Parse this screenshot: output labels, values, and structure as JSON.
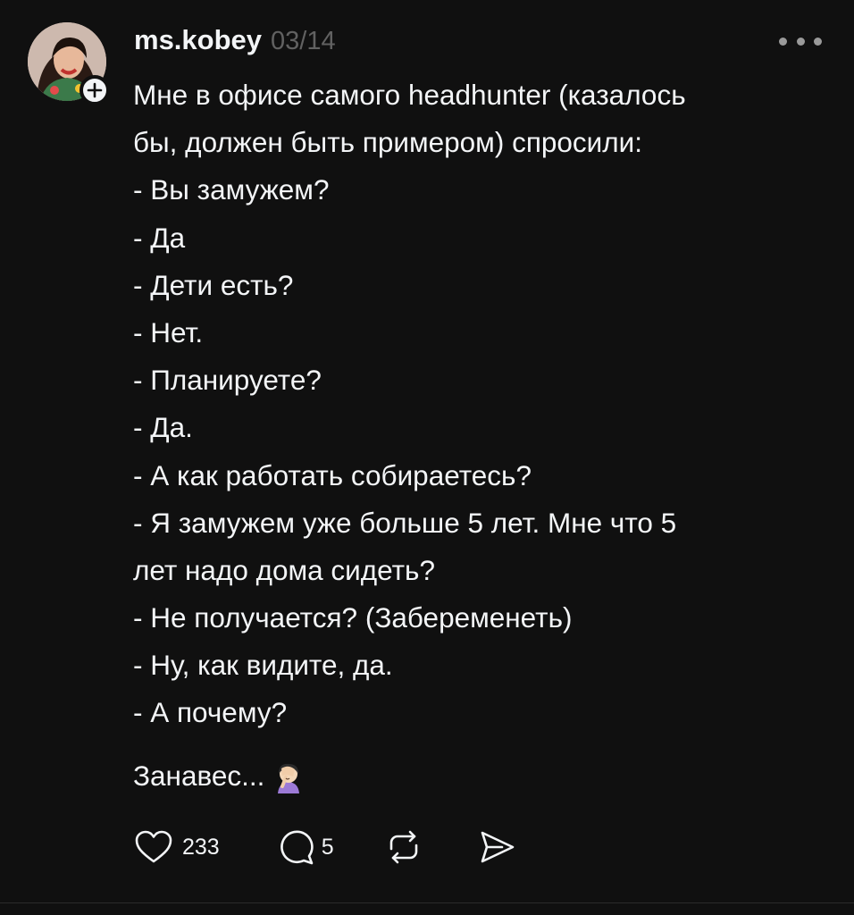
{
  "post": {
    "author": {
      "username": "ms.kobey",
      "avatar_icon": "profile-photo-icon",
      "follow_icon": "plus-icon"
    },
    "timestamp": "03/14",
    "more_icon": "more-dots-icon",
    "lines": [
      "Мне в офисе самого headhunter (казалось",
      "бы, должен быть примером) спросили:",
      "- Вы замужем?",
      "- Да",
      "- Дети есть?",
      "- Нет.",
      "- Планируете?",
      "- Да.",
      "- А как работать собираетесь?",
      "- Я замужем уже больше 5 лет. Мне что 5",
      "лет надо дома сидеть?",
      "- Не получается? (Забеременеть)",
      "- Ну, как видите, да.",
      "- А почему?"
    ],
    "closing_line": "Занавес...",
    "closing_emoji": "face-palm-emoji-icon"
  },
  "actions": {
    "likes": "233",
    "replies": "5",
    "like_icon": "heart-icon",
    "reply_icon": "comment-icon",
    "repost_icon": "repost-icon",
    "share_icon": "send-icon"
  },
  "colors": {
    "background": "#101010",
    "text": "#f3f5f7",
    "muted": "#616161"
  }
}
